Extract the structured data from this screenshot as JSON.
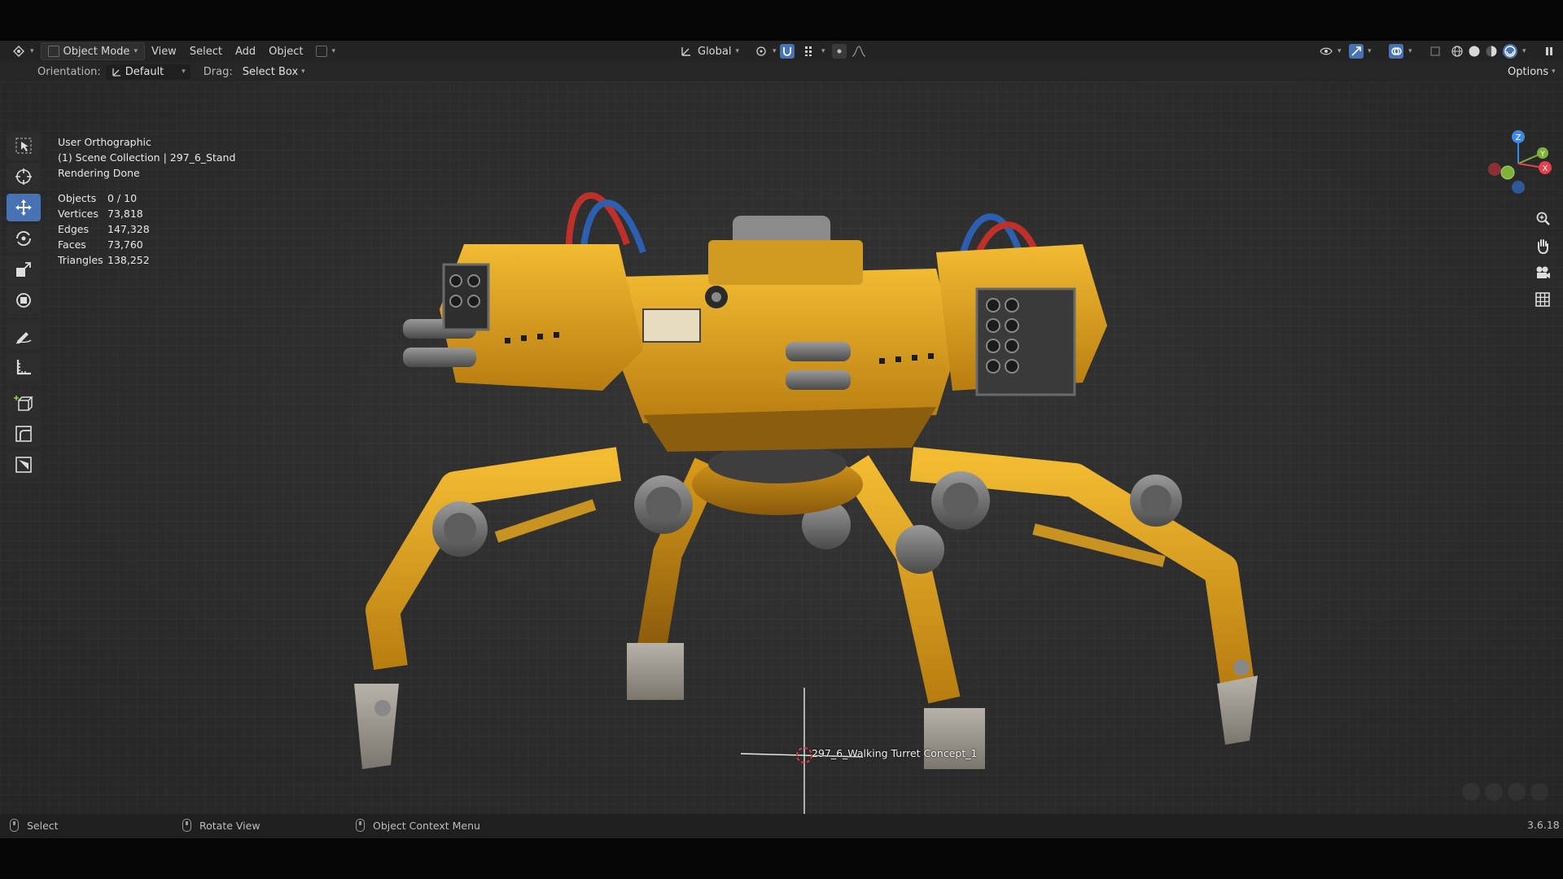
{
  "header": {
    "mode_label": "Object Mode",
    "menu": [
      "View",
      "Select",
      "Add",
      "Object"
    ],
    "transform_orientation": "Global"
  },
  "tool_settings": {
    "orientation_label": "Orientation:",
    "orientation_value": "Default",
    "drag_label": "Drag:",
    "drag_value": "Select Box",
    "options_label": "Options"
  },
  "viewport": {
    "view_name": "User Orthographic",
    "collection": "(1) Scene Collection | 297_6_Stand",
    "render_status": "Rendering Done",
    "stats": [
      {
        "key": "Objects",
        "value": "0 / 10"
      },
      {
        "key": "Vertices",
        "value": "73,818"
      },
      {
        "key": "Edges",
        "value": "147,328"
      },
      {
        "key": "Faces",
        "value": "73,760"
      },
      {
        "key": "Triangles",
        "value": "138,252"
      }
    ],
    "object_label": "297_6_Walking Turret Concept_1",
    "gizmo_axes": {
      "z": "Z",
      "y": "Y",
      "x": "X"
    },
    "colors": {
      "accent": "#4772b3",
      "model_yellow": "#e6a91c",
      "axis_x": "#e5424e",
      "axis_y": "#7fb23a",
      "axis_z": "#3f8ae0"
    }
  },
  "toolbar": {
    "tools": [
      "select-box",
      "cursor",
      "move",
      "rotate",
      "scale",
      "transform",
      "annotate",
      "measure",
      "add-cube",
      "shear",
      "scale-cage"
    ],
    "active_tool": "move"
  },
  "status_bar": {
    "select": "Select",
    "rotate_view": "Rotate View",
    "context_menu": "Object Context Menu",
    "version": "3.6.18"
  }
}
